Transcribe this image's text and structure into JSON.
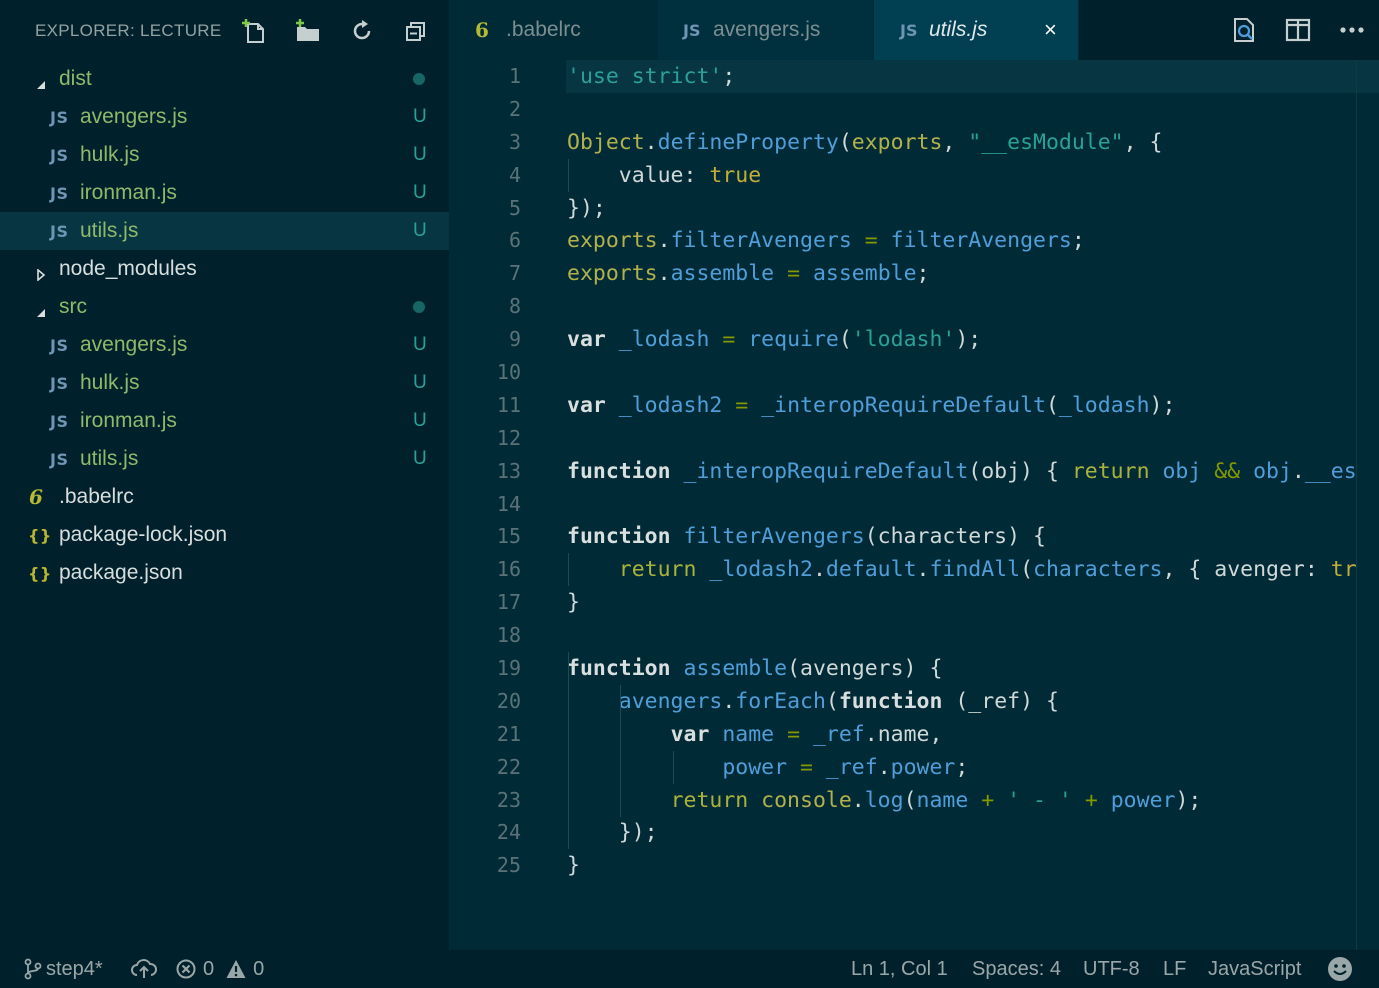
{
  "sidebar": {
    "title": "EXPLORER: LECTURE",
    "actions": [
      {
        "name": "new-file-icon"
      },
      {
        "name": "new-folder-icon"
      },
      {
        "name": "refresh-icon"
      },
      {
        "name": "collapse-all-icon"
      }
    ],
    "tree": [
      {
        "label": "dist",
        "type": "folder",
        "expanded": true,
        "depth": 0,
        "dot": true
      },
      {
        "label": "avengers.js",
        "type": "js",
        "depth": 1,
        "git": "U"
      },
      {
        "label": "hulk.js",
        "type": "js",
        "depth": 1,
        "git": "U"
      },
      {
        "label": "ironman.js",
        "type": "js",
        "depth": 1,
        "git": "U"
      },
      {
        "label": "utils.js",
        "type": "js",
        "depth": 1,
        "git": "U",
        "selected": true
      },
      {
        "label": "node_modules",
        "type": "folder",
        "expanded": false,
        "depth": 0
      },
      {
        "label": "src",
        "type": "folder",
        "expanded": true,
        "depth": 0,
        "dot": true
      },
      {
        "label": "avengers.js",
        "type": "js",
        "depth": 1,
        "git": "U"
      },
      {
        "label": "hulk.js",
        "type": "js",
        "depth": 1,
        "git": "U"
      },
      {
        "label": "ironman.js",
        "type": "js",
        "depth": 1,
        "git": "U"
      },
      {
        "label": "utils.js",
        "type": "js",
        "depth": 1,
        "git": "U"
      },
      {
        "label": ".babelrc",
        "type": "babel",
        "depth": 0
      },
      {
        "label": "package-lock.json",
        "type": "json",
        "depth": 0
      },
      {
        "label": "package.json",
        "type": "json",
        "depth": 0
      }
    ],
    "icons": {
      "js": "JS",
      "babel": "6",
      "json": "{}"
    }
  },
  "tabs": [
    {
      "label": ".babelrc",
      "icon": "6",
      "state": "normal"
    },
    {
      "label": "avengers.js",
      "icon": "JS",
      "state": "inactive"
    },
    {
      "label": "utils.js",
      "icon": "JS",
      "state": "active",
      "close": "×"
    }
  ],
  "editor_actions": [
    {
      "name": "find-in-files-icon"
    },
    {
      "name": "split-editor-icon"
    },
    {
      "name": "more-actions-icon"
    }
  ],
  "line_numbers": [
    "1",
    "2",
    "3",
    "4",
    "5",
    "6",
    "7",
    "8",
    "9",
    "10",
    "11",
    "12",
    "13",
    "14",
    "15",
    "16",
    "17",
    "18",
    "19",
    "20",
    "21",
    "22",
    "23",
    "24",
    "25"
  ],
  "code_lines": [
    [
      [
        "t-str",
        "'use strict'"
      ],
      [
        "t-punc",
        ";"
      ]
    ],
    [],
    [
      [
        "t-obj",
        "Object"
      ],
      [
        "t-punc",
        "."
      ],
      [
        "t-prop",
        "defineProperty"
      ],
      [
        "t-punc",
        "("
      ],
      [
        "t-obj",
        "exports"
      ],
      [
        "t-punc",
        ", "
      ],
      [
        "t-str",
        "\"__esModule\""
      ],
      [
        "t-punc",
        ", {"
      ]
    ],
    [
      [
        "t-plain",
        "    value: "
      ],
      [
        "t-kw2",
        "true"
      ]
    ],
    [
      [
        "t-punc",
        "});"
      ]
    ],
    [
      [
        "t-obj",
        "exports"
      ],
      [
        "t-punc",
        "."
      ],
      [
        "t-prop",
        "filterAvengers"
      ],
      [
        "t-op",
        " = "
      ],
      [
        "t-var",
        "filterAvengers"
      ],
      [
        "t-punc",
        ";"
      ]
    ],
    [
      [
        "t-obj",
        "exports"
      ],
      [
        "t-punc",
        "."
      ],
      [
        "t-prop",
        "assemble"
      ],
      [
        "t-op",
        " = "
      ],
      [
        "t-var",
        "assemble"
      ],
      [
        "t-punc",
        ";"
      ]
    ],
    [],
    [
      [
        "t-kw",
        "var "
      ],
      [
        "t-var",
        "_lodash"
      ],
      [
        "t-op",
        " = "
      ],
      [
        "t-fn",
        "require"
      ],
      [
        "t-punc",
        "("
      ],
      [
        "t-str",
        "'lodash'"
      ],
      [
        "t-punc",
        ");"
      ]
    ],
    [],
    [
      [
        "t-kw",
        "var "
      ],
      [
        "t-var",
        "_lodash2"
      ],
      [
        "t-op",
        " = "
      ],
      [
        "t-fn",
        "_interopRequireDefault"
      ],
      [
        "t-punc",
        "("
      ],
      [
        "t-var",
        "_lodash"
      ],
      [
        "t-punc",
        ");"
      ]
    ],
    [],
    [
      [
        "t-kw",
        "function "
      ],
      [
        "t-fn",
        "_interopRequireDefault"
      ],
      [
        "t-punc",
        "(obj) { "
      ],
      [
        "t-ret",
        "return "
      ],
      [
        "t-var",
        "obj "
      ],
      [
        "t-op",
        "&& "
      ],
      [
        "t-var",
        "obj"
      ],
      [
        "t-punc",
        "."
      ],
      [
        "t-prop",
        "__es"
      ]
    ],
    [],
    [
      [
        "t-kw",
        "function "
      ],
      [
        "t-fn",
        "filterAvengers"
      ],
      [
        "t-punc",
        "(characters) {"
      ]
    ],
    [
      [
        "t-plain",
        "    "
      ],
      [
        "t-ret",
        "return "
      ],
      [
        "t-var",
        "_lodash2"
      ],
      [
        "t-punc",
        "."
      ],
      [
        "t-prop",
        "default"
      ],
      [
        "t-punc",
        "."
      ],
      [
        "t-fn",
        "findAll"
      ],
      [
        "t-punc",
        "("
      ],
      [
        "t-var",
        "characters"
      ],
      [
        "t-punc",
        ", { avenger: "
      ],
      [
        "t-kw2",
        "tr"
      ]
    ],
    [
      [
        "t-punc",
        "}"
      ]
    ],
    [],
    [
      [
        "t-kw",
        "function "
      ],
      [
        "t-fn",
        "assemble"
      ],
      [
        "t-punc",
        "(avengers) {"
      ]
    ],
    [
      [
        "t-plain",
        "    "
      ],
      [
        "t-var",
        "avengers"
      ],
      [
        "t-punc",
        "."
      ],
      [
        "t-fn",
        "forEach"
      ],
      [
        "t-punc",
        "("
      ],
      [
        "t-kw",
        "function"
      ],
      [
        "t-punc",
        " (_ref) {"
      ]
    ],
    [
      [
        "t-plain",
        "        "
      ],
      [
        "t-kw",
        "var "
      ],
      [
        "t-var",
        "name"
      ],
      [
        "t-op",
        " = "
      ],
      [
        "t-var",
        "_ref"
      ],
      [
        "t-punc",
        ".name,"
      ]
    ],
    [
      [
        "t-plain",
        "            "
      ],
      [
        "t-var",
        "power"
      ],
      [
        "t-op",
        " = "
      ],
      [
        "t-var",
        "_ref"
      ],
      [
        "t-punc",
        "."
      ],
      [
        "t-prop",
        "power"
      ],
      [
        "t-punc",
        ";"
      ]
    ],
    [
      [
        "t-plain",
        "        "
      ],
      [
        "t-ret",
        "return "
      ],
      [
        "t-obj",
        "console"
      ],
      [
        "t-punc",
        "."
      ],
      [
        "t-fn",
        "log"
      ],
      [
        "t-punc",
        "("
      ],
      [
        "t-var",
        "name"
      ],
      [
        "t-op",
        " + "
      ],
      [
        "t-str",
        "' - '"
      ],
      [
        "t-op",
        " + "
      ],
      [
        "t-var",
        "power"
      ],
      [
        "t-punc",
        ");"
      ]
    ],
    [
      [
        "t-plain",
        "    "
      ],
      [
        "t-punc",
        "});"
      ]
    ],
    [
      [
        "t-punc",
        "}"
      ]
    ]
  ],
  "indent_guides": {
    "3": [
      0
    ],
    "15": [
      0
    ],
    "18": [
      0
    ],
    "19": [
      0,
      1
    ],
    "20": [
      0,
      1
    ],
    "21": [
      0,
      1,
      2
    ],
    "22": [
      0,
      1
    ],
    "23": [
      0
    ]
  },
  "statusbar": {
    "branch": "step4*",
    "errors": "0",
    "warnings": "0",
    "position": "Ln 1, Col 1",
    "spaces": "Spaces: 4",
    "encoding": "UTF-8",
    "eol": "LF",
    "language": "JavaScript"
  }
}
